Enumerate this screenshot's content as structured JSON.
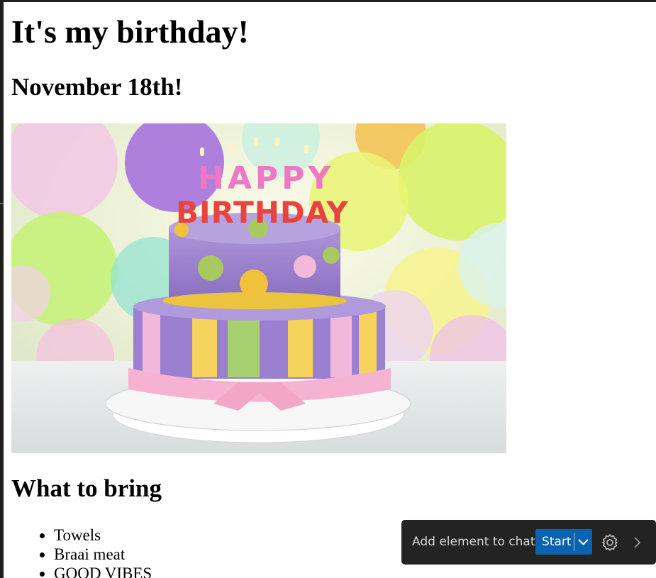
{
  "page": {
    "title": "It's my birthday!",
    "date_heading": "November 18th!",
    "bring_heading": "What to bring",
    "bring_items": [
      "Towels",
      "Braai meat",
      "GOOD VIBES"
    ]
  },
  "image": {
    "description_icon": "birthday-cake-image",
    "cake_letters_top": "HAPPY",
    "cake_letters_bottom": "BIRTHDAY"
  },
  "chat_toolbar": {
    "label": "Add element to chat",
    "start_label": "Start",
    "settings_icon": "gear-icon",
    "dropdown_icon": "chevron-down-icon",
    "collapse_icon": "chevron-right-icon",
    "accent": "#0a63b0",
    "background": "#232323"
  }
}
